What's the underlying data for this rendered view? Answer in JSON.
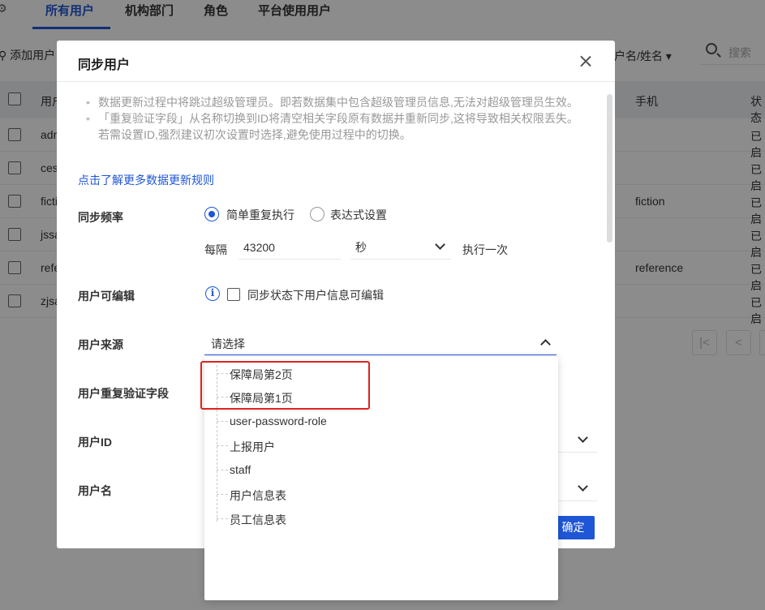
{
  "background": {
    "tabs": [
      {
        "label": "所有用户",
        "active": true
      },
      {
        "label": "机构部门",
        "active": false
      },
      {
        "label": "角色",
        "active": false
      },
      {
        "label": "平台使用用户",
        "active": false
      }
    ],
    "add_user_label": "添加用户",
    "filter_field": "户名/姓名",
    "search_placeholder": "搜索",
    "columns": {
      "user": "用户",
      "phone": "手机",
      "status": "状态"
    },
    "rows": [
      {
        "user": "adm",
        "phone": "",
        "status": "已启"
      },
      {
        "user": "ces",
        "phone": "",
        "status": "已启"
      },
      {
        "user": "ficti",
        "phone": "fiction",
        "status": "已启"
      },
      {
        "user": "jssa",
        "phone": "",
        "status": "已启"
      },
      {
        "user": "refe",
        "phone": "reference",
        "status": "已启"
      },
      {
        "user": "zjsa",
        "phone": "",
        "status": "已启"
      }
    ]
  },
  "modal": {
    "title": "同步用户",
    "notes": [
      "数据更新过程中将跳过超级管理员。即若数据集中包含超级管理员信息,无法对超级管理员生效。",
      "「重复验证字段」从名称切换到ID将清空相关字段原有数据并重新同步,这将导致相关权限丢失。若需设置ID,强烈建议初次设置时选择,避免使用过程中的切换。"
    ],
    "more_link": "点击了解更多数据更新规则",
    "sync_frequency": {
      "label": "同步频率",
      "option_simple": "简单重复执行",
      "option_expression": "表达式设置",
      "selected": "简单重复执行",
      "every_label": "每隔",
      "interval_value": "43200",
      "unit": "秒",
      "suffix": "执行一次"
    },
    "editable": {
      "label": "用户可编辑",
      "checkbox_label": "同步状态下用户信息可编辑",
      "checked": false
    },
    "source": {
      "label": "用户来源",
      "placeholder": "请选择",
      "options": [
        "保障局第2页",
        "保障局第1页",
        "user-password-role",
        "上报用户",
        "staff",
        "用户信息表",
        "员工信息表"
      ]
    },
    "dup_field_label": "用户重复验证字段",
    "user_id_label": "用户ID",
    "user_name_label": "用户名",
    "confirm_label": "确定"
  }
}
